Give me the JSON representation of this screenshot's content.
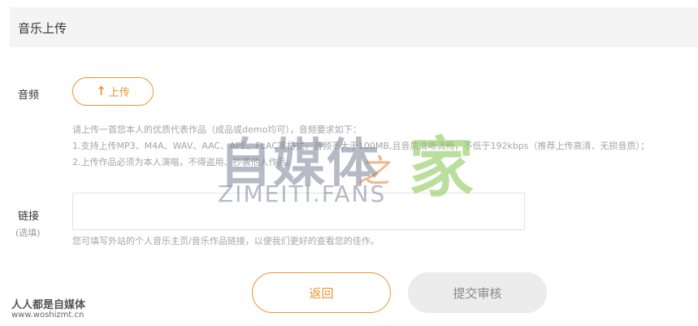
{
  "header": {
    "title": "音乐上传"
  },
  "audio": {
    "label": "音频",
    "upload_arrow": "↑",
    "upload_label": "上传",
    "hints": [
      "请上传一首您本人的优质代表作品（成品或demo均可），音频要求如下：",
      "1.支持上传MP3、M4A、WAV、AAC、APE、FLAC等格式，音频不大于100MB,且音质清晰流畅，不低于192kbps（推荐上传高清、无损音质）；",
      "2.上传作品必须为本人演唱，不得盗用、抄袭他人作品。"
    ]
  },
  "link": {
    "label": "链接",
    "sublabel": "(选填)",
    "value": "",
    "hint": "您可填写外站的个人音乐主页/音乐作品链接，以便我们更好的查看您的佳作。"
  },
  "actions": {
    "back_label": "返回",
    "submit_label": "提交审核"
  },
  "watermark": {
    "cn": "自媒体",
    "zhi": "之",
    "jia": "家",
    "en": "ZIMEITI.FANS"
  },
  "corner": {
    "cn": "人人都是自媒体",
    "url": "www.woshizmt.cn"
  },
  "colors": {
    "accent": "#e8962e",
    "disabled_bg": "#ececec",
    "hint_text": "#a5a5a5"
  }
}
